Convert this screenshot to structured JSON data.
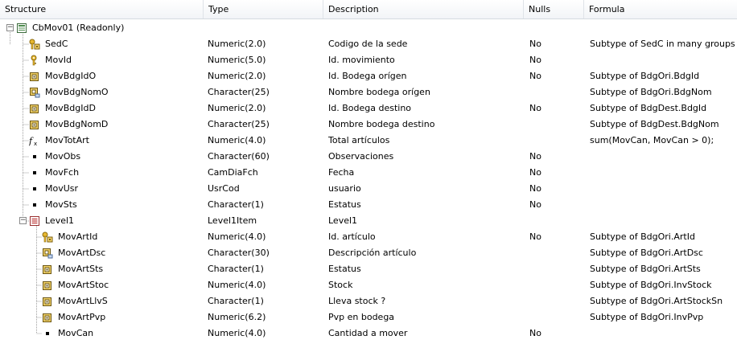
{
  "columns": {
    "structure": "Structure",
    "type": "Type",
    "description": "Description",
    "nulls": "Nulls",
    "formula": "Formula"
  },
  "rows": [
    {
      "name": "CbMov01 (Readonly)",
      "type": "",
      "description": "",
      "nulls": "",
      "formula": "",
      "icon": "transaction-icon",
      "level": 0,
      "expander": true
    },
    {
      "name": "SedC",
      "type": "Numeric(2.0)",
      "description": "Codigo de la sede",
      "nulls": "No",
      "formula": "Subtype of SedC in many groups",
      "icon": "inferred-key-icon",
      "level": 1
    },
    {
      "name": "MovId",
      "type": "Numeric(5.0)",
      "description": "Id. movimiento",
      "nulls": "No",
      "formula": "",
      "icon": "key-icon",
      "level": 1
    },
    {
      "name": "MovBdgIdO",
      "type": "Numeric(2.0)",
      "description": "Id. Bodega orígen",
      "nulls": "No",
      "formula": "Subtype of BdgOri.BdgId",
      "icon": "subtype-icon",
      "level": 1
    },
    {
      "name": "MovBdgNomO",
      "type": "Character(25)",
      "description": "Nombre bodega orígen",
      "nulls": "",
      "formula": "Subtype of BdgOri.BdgNom",
      "icon": "inferred-subtype-icon",
      "level": 1
    },
    {
      "name": "MovBdgIdD",
      "type": "Numeric(2.0)",
      "description": "Id. Bodega destino",
      "nulls": "No",
      "formula": "Subtype of BdgDest.BdgId",
      "icon": "subtype-icon",
      "level": 1
    },
    {
      "name": "MovBdgNomD",
      "type": "Character(25)",
      "description": "Nombre bodega destino",
      "nulls": "",
      "formula": "Subtype of BdgDest.BdgNom",
      "icon": "subtype-icon",
      "level": 1
    },
    {
      "name": "MovTotArt",
      "type": "Numeric(4.0)",
      "description": "Total artículos",
      "nulls": "",
      "formula": "sum(MovCan, MovCan > 0);",
      "icon": "formula-icon",
      "level": 1
    },
    {
      "name": "MovObs",
      "type": "Character(60)",
      "description": "Observaciones",
      "nulls": "No",
      "formula": "",
      "icon": "attribute-dot-icon",
      "level": 1
    },
    {
      "name": "MovFch",
      "type": "CamDiaFch",
      "description": "Fecha",
      "nulls": "No",
      "formula": "",
      "icon": "attribute-dot-icon",
      "level": 1
    },
    {
      "name": "MovUsr",
      "type": "UsrCod",
      "description": "usuario",
      "nulls": "No",
      "formula": "",
      "icon": "attribute-dot-icon",
      "level": 1
    },
    {
      "name": "MovSts",
      "type": "Character(1)",
      "description": "Estatus",
      "nulls": "No",
      "formula": "",
      "icon": "attribute-dot-icon",
      "level": 1
    },
    {
      "name": "Level1",
      "type": "Level1Item",
      "description": "Level1",
      "nulls": "",
      "formula": "",
      "icon": "level-icon",
      "level": 1,
      "expander": true
    },
    {
      "name": "MovArtId",
      "type": "Numeric(4.0)",
      "description": "Id. artículo",
      "nulls": "No",
      "formula": "Subtype of BdgOri.ArtId",
      "icon": "inferred-key-icon",
      "level": 2
    },
    {
      "name": "MovArtDsc",
      "type": "Character(30)",
      "description": "Descripción artículo",
      "nulls": "",
      "formula": "Subtype of BdgOri.ArtDsc",
      "icon": "inferred-subtype-icon",
      "level": 2
    },
    {
      "name": "MovArtSts",
      "type": "Character(1)",
      "description": "Estatus",
      "nulls": "",
      "formula": "Subtype of BdgOri.ArtSts",
      "icon": "subtype-icon",
      "level": 2
    },
    {
      "name": "MovArtStoc",
      "type": "Numeric(4.0)",
      "description": "Stock",
      "nulls": "",
      "formula": "Subtype of BdgOri.InvStock",
      "icon": "subtype-icon",
      "level": 2
    },
    {
      "name": "MovArtLlvS",
      "type": "Character(1)",
      "description": "Lleva stock ?",
      "nulls": "",
      "formula": "Subtype of BdgOri.ArtStockSn",
      "icon": "subtype-icon",
      "level": 2
    },
    {
      "name": "MovArtPvp",
      "type": "Numeric(6.2)",
      "description": "Pvp en bodega",
      "nulls": "",
      "formula": "Subtype of BdgOri.InvPvp",
      "icon": "subtype-icon",
      "level": 2
    },
    {
      "name": "MovCan",
      "type": "Numeric(4.0)",
      "description": "Cantidad a mover",
      "nulls": "No",
      "formula": "",
      "icon": "attribute-dot-icon",
      "level": 2
    }
  ]
}
